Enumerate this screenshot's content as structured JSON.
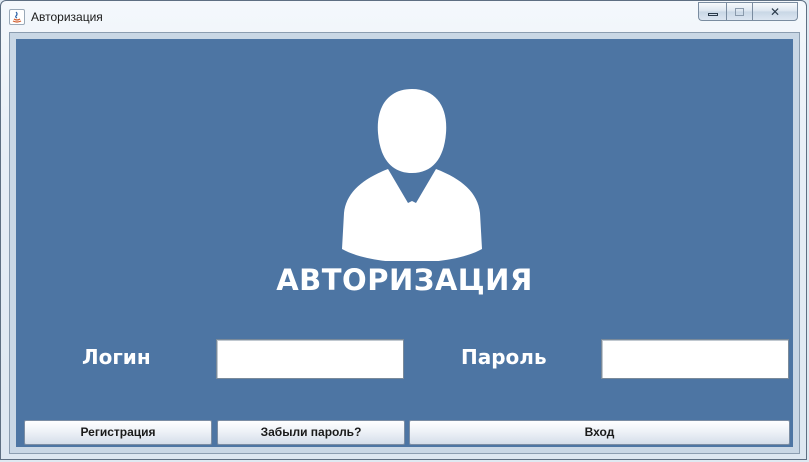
{
  "window": {
    "title": "Авторизация",
    "controls": {
      "minimize": "▭",
      "maximize": "□",
      "close": "✕"
    }
  },
  "panel": {
    "background": "#4d75a3",
    "avatar_icon": "user-avatar-icon",
    "heading": "АВТОРИЗАЦИЯ"
  },
  "form": {
    "login_label": "Логин",
    "login_value": "",
    "password_label": "Пароль",
    "password_value": ""
  },
  "buttons": {
    "register": "Регистрация",
    "forgot": "Забыли пароль?",
    "login": "Вход"
  }
}
